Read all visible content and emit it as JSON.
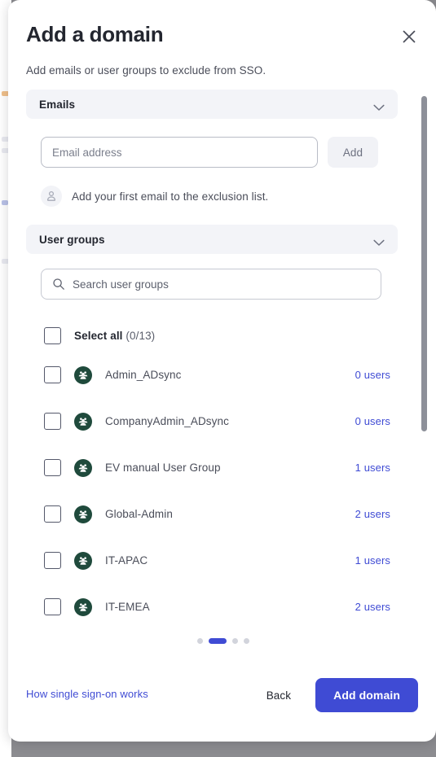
{
  "colors": {
    "accent": "#3f4bd4",
    "group_avatar": "#1f4a3c",
    "section_bar_bg": "#f3f4f8",
    "text_primary": "#23262f",
    "text_secondary": "#4a4d59",
    "scrollbar_thumb": "#8d9099"
  },
  "header": {
    "title": "Add a domain",
    "subtitle": "Add emails or user groups to exclude from SSO.",
    "close_icon": "close-icon"
  },
  "emails_section": {
    "label": "Emails",
    "chevron_icon": "chevron-down-icon",
    "input_placeholder": "Email address",
    "input_value": "",
    "add_label": "Add",
    "empty_hint": "Add your first email to the exclusion list.",
    "empty_hint_icon": "person-icon"
  },
  "user_groups_section": {
    "label": "User groups",
    "chevron_icon": "chevron-down-icon",
    "search_placeholder": "Search user groups",
    "search_value": "",
    "search_icon": "search-icon",
    "select_all": {
      "label": "Select all",
      "count": "(0/13)",
      "checked": false
    },
    "rows": [
      {
        "name": "Admin_ADsync",
        "users": "0 users",
        "checked": false,
        "icon": "user-group-icon"
      },
      {
        "name": "CompanyAdmin_ADsync",
        "users": "0 users",
        "checked": false,
        "icon": "user-group-icon"
      },
      {
        "name": "EV manual User Group",
        "users": "1 users",
        "checked": false,
        "icon": "user-group-icon"
      },
      {
        "name": "Global-Admin",
        "users": "2 users",
        "checked": false,
        "icon": "user-group-icon"
      },
      {
        "name": "IT-APAC",
        "users": "1 users",
        "checked": false,
        "icon": "user-group-icon"
      },
      {
        "name": "IT-EMEA",
        "users": "2 users",
        "checked": false,
        "icon": "user-group-icon"
      }
    ]
  },
  "pagination": {
    "total": 4,
    "active_index": 1
  },
  "footer": {
    "help_link": "How single sign-on works",
    "back_label": "Back",
    "primary_label": "Add domain"
  }
}
